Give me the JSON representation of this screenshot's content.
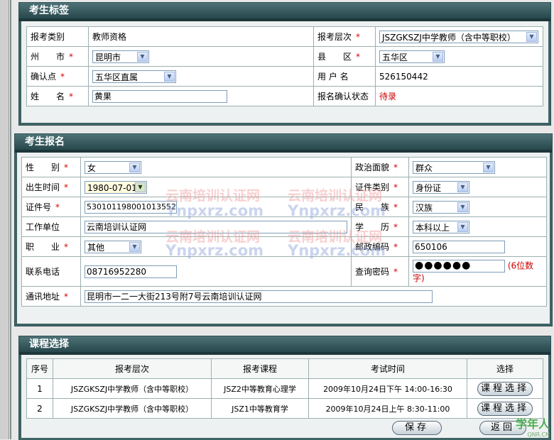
{
  "section1": {
    "title": "考生标签",
    "exam_type": {
      "label": "报考类别",
      "value": "教师资格"
    },
    "level": {
      "label": "报考层次",
      "value": "JSZGKSZJ中学教师（含中等职校）"
    },
    "city": {
      "label": "州　　市",
      "value": "昆明市"
    },
    "county": {
      "label": "县　　区",
      "value": "五华区"
    },
    "confirm_point": {
      "label": "确认点",
      "value": "五华区直属"
    },
    "username": {
      "label": "用 户 名",
      "value": "526150442"
    },
    "name": {
      "label": "姓　　名",
      "value": "黄果"
    },
    "status": {
      "label": "报名确认状态",
      "value": "待录"
    }
  },
  "section2": {
    "title": "考生报名",
    "gender": {
      "label": "性　　别",
      "value": "女"
    },
    "politics": {
      "label": "政治面貌",
      "value": "群众"
    },
    "birth": {
      "label": "出生时间",
      "value": "1980-07-01"
    },
    "id_type": {
      "label": "证件类别",
      "value": "身份证"
    },
    "id_no": {
      "label": "证件号",
      "value": "530101198001013552"
    },
    "nation": {
      "label": "民　　族",
      "value": "汉族"
    },
    "work": {
      "label": "工作单位",
      "value": "云南培训认证网"
    },
    "education": {
      "label": "学　　历",
      "value": "本科以上"
    },
    "job": {
      "label": "职　　业",
      "value": "其他"
    },
    "postcode": {
      "label": "邮政编码",
      "value": "650106"
    },
    "phone": {
      "label": "联系电话",
      "value": "08716952280"
    },
    "password": {
      "label": "查询密码",
      "value": "●●●●●●",
      "hint": "(6位数字)"
    },
    "address": {
      "label": "通讯地址",
      "value": "昆明市一二一大街213号附7号云南培训认证网"
    },
    "required_mark": "*"
  },
  "watermark": {
    "cn": "云南培训认证网",
    "en": "Ynpxrz.com"
  },
  "section3": {
    "title": "课程选择",
    "headers": [
      "序号",
      "报考层次",
      "报考课程",
      "考试时间",
      "选择"
    ],
    "rows": [
      {
        "no": "1",
        "level": "JSZGKSZJ中学教师（含中等职校）",
        "course": "JSZ2中等教育心理学",
        "time": "2009年10月24日下午 14:00-16:30",
        "action": "课程选择"
      },
      {
        "no": "2",
        "level": "JSZGKSZJ中学教师（含中等职校）",
        "course": "JSZ1中等教育学",
        "time": "2009年10月24日上午 8:30-11:00",
        "action": "课程选择"
      }
    ]
  },
  "buttons": {
    "save": "保存",
    "back": "返回"
  },
  "logo": {
    "text": "学年人",
    "sub": "QNR.CN"
  }
}
